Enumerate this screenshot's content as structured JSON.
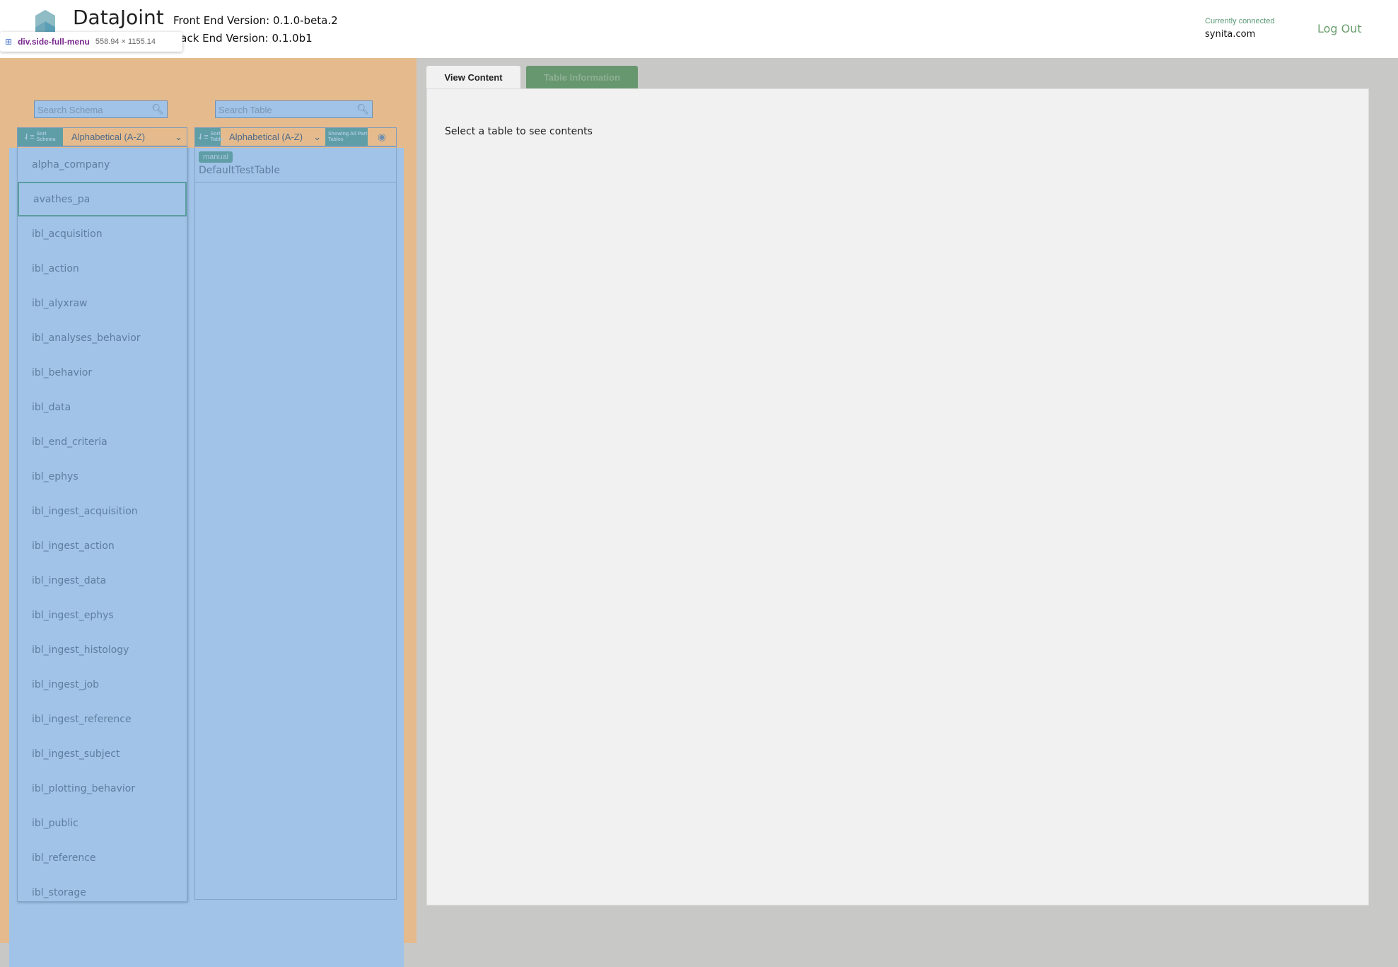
{
  "header": {
    "brand": "DataJoint",
    "front_end": "Front End Version: 0.1.0-beta.2",
    "back_end": "Back End Version: 0.1.0b1",
    "connected_label": "Currently connected",
    "host": "synita.com",
    "logout": "Log Out"
  },
  "tooltip": {
    "selector": "div.side-full-menu",
    "size": "558.94 × 1155.14"
  },
  "schema": {
    "search_placeholder": "Search Schema",
    "sort_label": "Sort Schema",
    "sort_value": "Alphabetical (A-Z)",
    "selected": "avathes_pa",
    "items": [
      "alpha_company",
      "avathes_pa",
      "ibl_acquisition",
      "ibl_action",
      "ibl_alyxraw",
      "ibl_analyses_behavior",
      "ibl_behavior",
      "ibl_data",
      "ibl_end_criteria",
      "ibl_ephys",
      "ibl_ingest_acquisition",
      "ibl_ingest_action",
      "ibl_ingest_data",
      "ibl_ingest_ephys",
      "ibl_ingest_histology",
      "ibl_ingest_job",
      "ibl_ingest_reference",
      "ibl_ingest_subject",
      "ibl_plotting_behavior",
      "ibl_public",
      "ibl_reference",
      "ibl_storage"
    ]
  },
  "table": {
    "search_placeholder": "Search Table",
    "sort_label": "Sort Table",
    "sort_value": "Alphabetical (A-Z)",
    "part_toggle": "Showing All Part Tables",
    "items": [
      {
        "tier": "manual",
        "name": "DefaultTestTable"
      }
    ]
  },
  "tabs": [
    {
      "label": "View Content",
      "active": true
    },
    {
      "label": "Table Information",
      "active": false
    }
  ],
  "main": {
    "message": "Select a table to see contents"
  },
  "colors": {
    "overlay_margin": "#e5bb8d",
    "overlay_content": "#a0c3e7",
    "accent": "#5f9ea6",
    "inactive_tab": "#67976f"
  }
}
